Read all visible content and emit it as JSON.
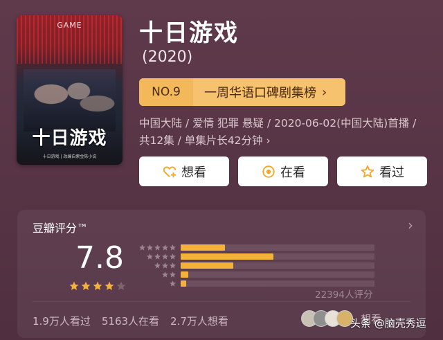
{
  "poster": {
    "top_text": "GAME",
    "title_art": "十日游戏",
    "sub_text": "十日游戏 | 改编自紫金陈小说",
    "alt_icon": "poster-image"
  },
  "title": "十日游戏",
  "year": "(2020)",
  "rank": {
    "number": "NO.9",
    "list_name": "一周华语口碑剧集榜",
    "chevron": "›"
  },
  "meta": {
    "text": "中国大陆 / 爱情 犯罪 悬疑 / 2020-06-02(中国大陆)首播 / 共12集 / 单集片长42分钟",
    "chevron": "›"
  },
  "actions": [
    {
      "label": "想看",
      "icon": "heart-plus-icon"
    },
    {
      "label": "在看",
      "icon": "circle-dot-icon"
    },
    {
      "label": "看过",
      "icon": "star-outline-icon"
    }
  ],
  "rating": {
    "title": "豆瓣评分™",
    "score": "7.8",
    "stars_filled": 4,
    "stars_total": 5,
    "distribution": [
      {
        "stars": 5,
        "fraction": 0.23
      },
      {
        "stars": 4,
        "fraction": 0.48
      },
      {
        "stars": 3,
        "fraction": 0.27
      },
      {
        "stars": 2,
        "fraction": 0.04
      },
      {
        "stars": 1,
        "fraction": 0.03
      }
    ],
    "votes": "22394人评分",
    "chevron": "›"
  },
  "stats": {
    "watched": "1.9万人看过",
    "watching": "5163人在看",
    "want": "2.7万人想看"
  },
  "friends": {
    "label": "想看"
  },
  "watermark": "头条 @脑壳秀逗",
  "colors": {
    "background": "#5a3647",
    "accent_star": "#f5b23a",
    "rank_badge": "#f6c26e"
  }
}
